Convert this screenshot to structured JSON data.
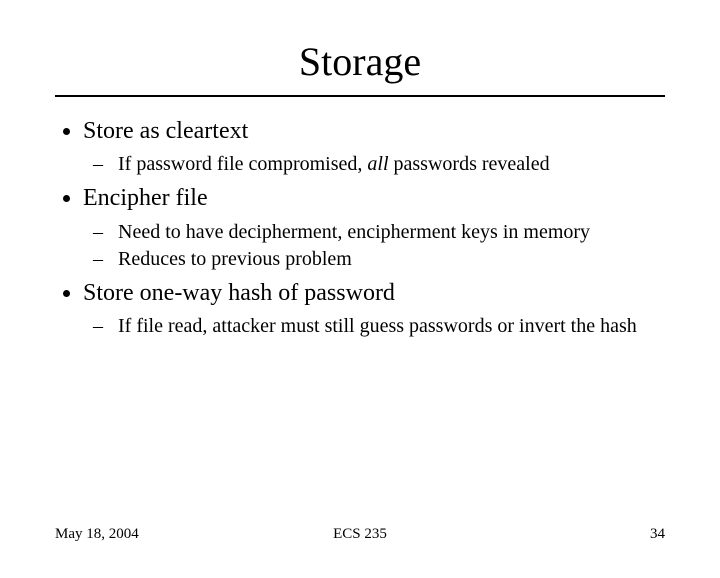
{
  "title": "Storage",
  "bullets": [
    {
      "text": "Store as cleartext",
      "sub": [
        {
          "prefix": "If password file compromised, ",
          "em": "all",
          "suffix": " passwords revealed"
        }
      ]
    },
    {
      "text": "Encipher file",
      "sub": [
        {
          "prefix": "Need to have decipherment, encipherment keys in memory",
          "em": "",
          "suffix": ""
        },
        {
          "prefix": "Reduces to previous problem",
          "em": "",
          "suffix": ""
        }
      ]
    },
    {
      "text": "Store one-way hash of password",
      "sub": [
        {
          "prefix": "If file read, attacker must still guess passwords or invert the hash",
          "em": "",
          "suffix": ""
        }
      ]
    }
  ],
  "footer": {
    "date": "May 18, 2004",
    "course": "ECS 235",
    "page": "34"
  }
}
